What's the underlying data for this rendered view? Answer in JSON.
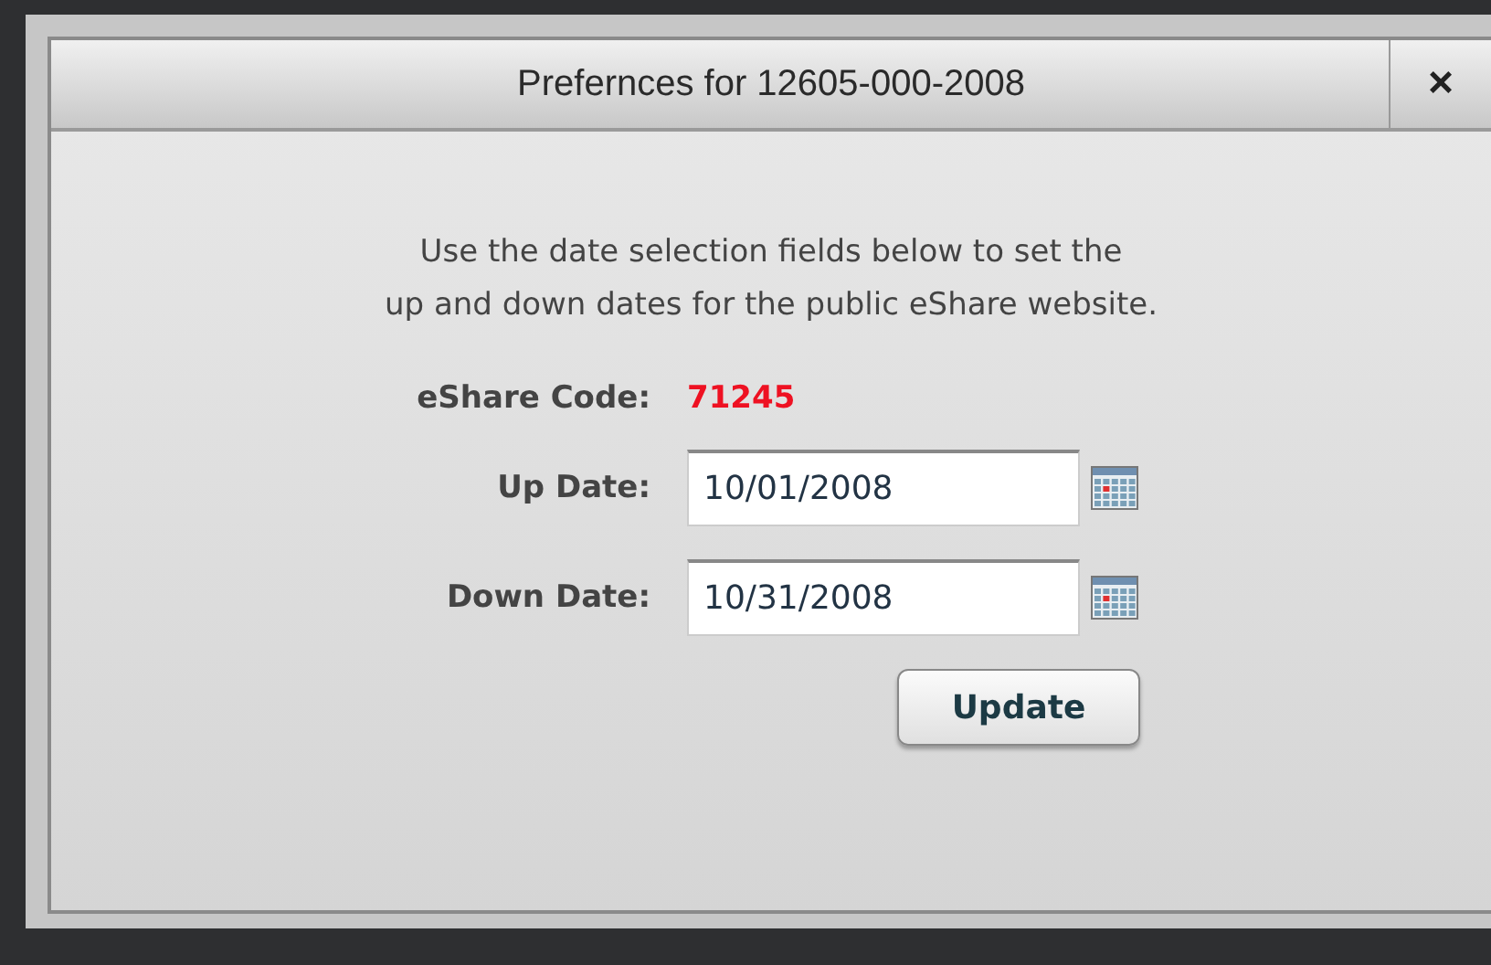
{
  "window": {
    "title": "Prefernces for 12605-000-2008",
    "close": "×"
  },
  "intro": [
    "Use the date selection fields below to set the",
    "up and down dates for the public eShare website."
  ],
  "code": {
    "label": "eShare Code:",
    "value": "71245"
  },
  "fields": [
    {
      "label": "Up Date:",
      "value": "10/01/2008"
    },
    {
      "label": "Down Date:",
      "value": "10/31/2008"
    }
  ],
  "button": "Update"
}
